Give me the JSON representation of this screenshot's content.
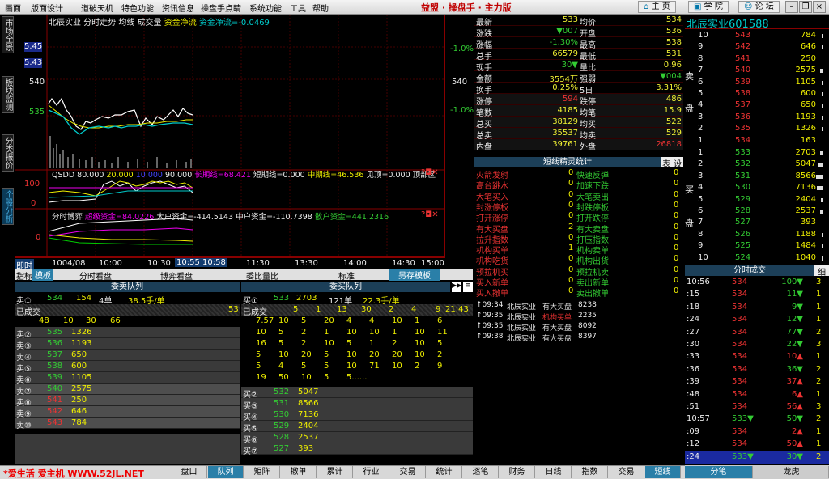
{
  "menu": [
    "画面",
    "版面设计",
    "道破天机",
    "特色功能",
    "资讯信息",
    "操盘手点睛",
    "系统功能",
    "工具",
    "帮助"
  ],
  "app_title": "益盟 · 操盘手 · 主力版",
  "toolbar": {
    "home": "主 页",
    "school": "学 院",
    "forum": "论 坛"
  },
  "left_tabs": [
    "市场全景",
    "板块监测",
    "分类报价",
    "个股分析"
  ],
  "chart": {
    "header": {
      "name": "北辰实业",
      "t1": "分时走势",
      "t2": "均线",
      "t3": "成交量",
      "t4": "资金净流",
      "t5": "资金净流=-0.0469"
    },
    "price_tags": [
      "5.45",
      "5.43"
    ],
    "left_y": [
      "540",
      "535"
    ],
    "right_y": [
      "-1.0%",
      "540",
      "-1.0%"
    ],
    "qsdd": {
      "label": "QSDD",
      "v1": "80.000",
      "v2": "20.000",
      "v3": "10.000",
      "v4": "90.000",
      "long": "长期线=68.421",
      "short": "短期线=0.000",
      "mid": "中期线=46.536",
      "see": "见顶=0.000",
      "top": "顶部区"
    },
    "qsdd_y": [
      "100",
      "0"
    ],
    "bo": {
      "label": "分时博弈",
      "super": "超级资金=84.0226",
      "big": "大户资金=-414.5143",
      "mid": "中户资金=-110.7398",
      "small": "散户资金=441.2316"
    },
    "bo_y": [
      "0"
    ],
    "time_labels": [
      "1004/08",
      "10:00",
      "10:30",
      "10:55",
      "10:58",
      "11:30",
      "13:30",
      "14:00",
      "14:30",
      "15:00"
    ],
    "timebar_left": "即时"
  },
  "lower_tabs": [
    "指标",
    "模板",
    "分时看盘",
    "博弈看盘",
    "委比量比",
    "标准",
    "另存模板"
  ],
  "queue": {
    "head_left": "委卖队列",
    "head_right": "委买队列",
    "sell1": {
      "label": "卖①",
      "price": "534",
      "vol": "154",
      "orders": "4单",
      "avg": "38.5手/单"
    },
    "buy1": {
      "label": "买①",
      "price": "533",
      "vol": "2703",
      "orders": "121单",
      "avg": "22.3手/单"
    },
    "done_left": "已成交",
    "done_left_v": "53",
    "done_right": "已成交",
    "done_right_v": "21:43",
    "done_left_nums": [
      "48",
      "10",
      "30",
      "66"
    ],
    "done_right_nums": [
      "5",
      "1",
      "13",
      "30",
      "2",
      "4",
      "9"
    ],
    "buy_queue_rows": [
      [
        "7.57",
        "10",
        "5",
        "20",
        "4",
        "4",
        "10",
        "1",
        "6"
      ],
      [
        "10",
        "5",
        "2",
        "1",
        "10",
        "10",
        "1",
        "10",
        "11"
      ],
      [
        "16",
        "5",
        "2",
        "10",
        "5",
        "1",
        "2",
        "10",
        "5"
      ],
      [
        "5",
        "10",
        "20",
        "5",
        "10",
        "20",
        "20",
        "10",
        "2"
      ],
      [
        "5",
        "4",
        "5",
        "5",
        "10",
        "71",
        "10",
        "2",
        "9"
      ],
      [
        "19",
        "50",
        "10",
        "5",
        "5......",
        "",
        "",
        "",
        ""
      ]
    ],
    "sells": [
      {
        "label": "卖②",
        "price": "535",
        "vol": "1326"
      },
      {
        "label": "卖③",
        "price": "536",
        "vol": "1193"
      },
      {
        "label": "卖④",
        "price": "537",
        "vol": "650"
      },
      {
        "label": "卖⑤",
        "price": "538",
        "vol": "600"
      },
      {
        "label": "卖⑥",
        "price": "539",
        "vol": "1105"
      },
      {
        "label": "卖⑦",
        "price": "540",
        "vol": "2575"
      },
      {
        "label": "卖⑧",
        "price": "541",
        "vol": "250"
      },
      {
        "label": "卖⑨",
        "price": "542",
        "vol": "646"
      },
      {
        "label": "卖⑩",
        "price": "543",
        "vol": "784"
      }
    ],
    "buys": [
      {
        "label": "买②",
        "price": "532",
        "vol": "5047"
      },
      {
        "label": "买③",
        "price": "531",
        "vol": "8566"
      },
      {
        "label": "买④",
        "price": "530",
        "vol": "7136"
      },
      {
        "label": "买⑤",
        "price": "529",
        "vol": "2404"
      },
      {
        "label": "买⑥",
        "price": "528",
        "vol": "2537"
      },
      {
        "label": "买⑦",
        "price": "527",
        "vol": "393"
      }
    ]
  },
  "quote": {
    "rows": [
      [
        "最新",
        "533",
        "均价",
        "534"
      ],
      [
        "涨跌",
        "▼007",
        "开盘",
        "536"
      ],
      [
        "涨幅",
        "-1.30%",
        "最高",
        "538"
      ],
      [
        "总手",
        "66579",
        "最低",
        "531"
      ],
      [
        "现手",
        "30▼",
        "量比",
        "0.96"
      ],
      [
        "金额",
        "3554万",
        "强弱",
        "▼004"
      ],
      [
        "换手",
        "0.25%",
        "5日",
        "3.31%"
      ],
      [
        "涨停",
        "594",
        "跌停",
        "486"
      ],
      [
        "笔数",
        "4185",
        "均笔",
        "15.9"
      ],
      [
        "总买",
        "38129",
        "均买",
        "522"
      ],
      [
        "总卖",
        "35537",
        "均卖",
        "529"
      ],
      [
        "内盘",
        "39761",
        "外盘",
        "26818"
      ]
    ],
    "spirit_title": "短线精灵统计",
    "spirit_btn1": "表",
    "spirit_btn2": "设",
    "spirit": [
      [
        "火箭发射",
        "0",
        "快速反弹",
        "0"
      ],
      [
        "高台跳水",
        "0",
        "加速下跌",
        "0"
      ],
      [
        "大笔买入",
        "0",
        "大笔卖出",
        "0"
      ],
      [
        "封涨停板",
        "0",
        "封跌停板",
        "0"
      ],
      [
        "打开涨停",
        "0",
        "打开跌停",
        "0"
      ],
      [
        "有大买盘",
        "2",
        "有大卖盘",
        "0"
      ],
      [
        "拉升指数",
        "0",
        "打压指数",
        "0"
      ],
      [
        "机构买单",
        "1",
        "机构卖单",
        "0"
      ],
      [
        "机构吃货",
        "0",
        "机构出货",
        "0"
      ],
      [
        "预拉机买",
        "0",
        "预拉机卖",
        "0"
      ],
      [
        "买入新单",
        "0",
        "卖出新单",
        "0"
      ],
      [
        "买入撤单",
        "0",
        "卖出撤单",
        "0"
      ]
    ],
    "events": [
      [
        "↑09:34",
        "北辰实业",
        "有大买盘",
        "8238"
      ],
      [
        "↑09:35",
        "北辰实业",
        "机构买单",
        "2235"
      ],
      [
        "↑09:35",
        "北辰实业",
        "有大买盘",
        "8092"
      ],
      [
        "↑09:38",
        "北辰实业",
        "有大买盘",
        "8397"
      ]
    ]
  },
  "stock_title": "北辰实业601588",
  "book": {
    "sell_label": "卖",
    "sell_label2": "盘",
    "buy_label": "买",
    "buy_label2": "盘",
    "sells": [
      [
        "10",
        "543",
        "784"
      ],
      [
        "9",
        "542",
        "646"
      ],
      [
        "8",
        "541",
        "250"
      ],
      [
        "7",
        "540",
        "2575"
      ],
      [
        "6",
        "539",
        "1105"
      ],
      [
        "5",
        "538",
        "600"
      ],
      [
        "4",
        "537",
        "650"
      ],
      [
        "3",
        "536",
        "1193"
      ],
      [
        "2",
        "535",
        "1326"
      ],
      [
        "1",
        "534",
        "163"
      ]
    ],
    "buys": [
      [
        "1",
        "533",
        "2703"
      ],
      [
        "2",
        "532",
        "5047"
      ],
      [
        "3",
        "531",
        "8566"
      ],
      [
        "4",
        "530",
        "7136"
      ],
      [
        "5",
        "529",
        "2404"
      ],
      [
        "6",
        "528",
        "2537"
      ],
      [
        "7",
        "527",
        "393"
      ],
      [
        "8",
        "526",
        "1188"
      ],
      [
        "9",
        "525",
        "1484"
      ],
      [
        "10",
        "524",
        "1040"
      ]
    ]
  },
  "ticks": {
    "title": "分时成交",
    "btn": "细",
    "rows": [
      [
        "10:56",
        "534",
        "100▼",
        "3"
      ],
      [
        ":15",
        "534",
        "11▼",
        "1"
      ],
      [
        ":18",
        "534",
        "9▼",
        "1"
      ],
      [
        ":24",
        "534",
        "12▼",
        "1"
      ],
      [
        ":27",
        "534",
        "77▼",
        "2"
      ],
      [
        ":30",
        "534",
        "22▼",
        "3"
      ],
      [
        ":33",
        "534",
        "10▲",
        "1"
      ],
      [
        ":36",
        "534",
        "36▼",
        "2"
      ],
      [
        ":39",
        "534",
        "37▲",
        "2"
      ],
      [
        ":48",
        "534",
        "6▲",
        "1"
      ],
      [
        ":51",
        "534",
        "56▲",
        "3"
      ],
      [
        "10:57",
        "533▼",
        "50▼",
        "2"
      ],
      [
        ":09",
        "534",
        "2▲",
        "1"
      ],
      [
        ":12",
        "534",
        "50▲",
        "1"
      ],
      [
        ":24",
        "533▼",
        "30▼",
        "2"
      ]
    ]
  },
  "right_bottom_tabs": [
    "分笔",
    "龙虎"
  ],
  "bottom_tabs": [
    "盘口",
    "队列",
    "矩阵",
    "撤单",
    "累计",
    "行业",
    "交易",
    "统计",
    "逐笔",
    "财务",
    "日线",
    "指数",
    "交易",
    "短线"
  ],
  "watermark": "*爱生活 爱主机 WWW.52JL.NET",
  "colors": {
    "up": "#ee3333",
    "down": "#33cc33",
    "accent": "#ffff00",
    "panel": "#1c3f58"
  }
}
